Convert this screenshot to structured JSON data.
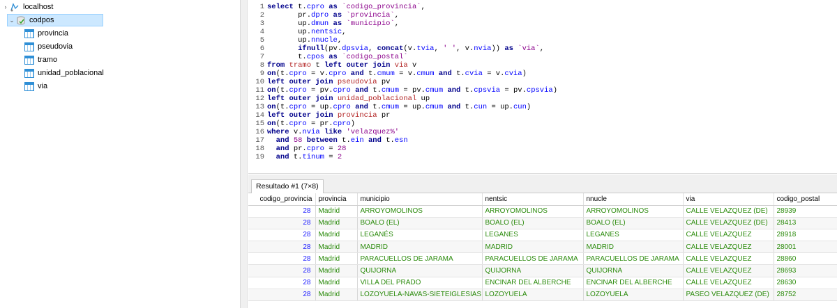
{
  "colors": {
    "keyword": "#00008b",
    "string": "#8b008b",
    "table": "#b22222",
    "number_cell": "#1a1aff",
    "text_cell": "#2b8b0c",
    "selected_bg": "#cce8ff"
  },
  "tree": {
    "server": {
      "label": "localhost",
      "icon": "server-icon"
    },
    "database": {
      "label": "codpos",
      "icon": "database-icon",
      "expanded": true
    },
    "tables": [
      {
        "label": "provincia",
        "icon": "table-icon"
      },
      {
        "label": "pseudovia",
        "icon": "table-icon"
      },
      {
        "label": "tramo",
        "icon": "table-icon"
      },
      {
        "label": "unidad_poblacional",
        "icon": "table-icon"
      },
      {
        "label": "via",
        "icon": "table-icon"
      }
    ]
  },
  "editor": {
    "lines": [
      {
        "n": "1",
        "tokens": [
          [
            "kw",
            "select "
          ],
          [
            "plain",
            "t."
          ],
          [
            "col",
            "cpro"
          ],
          [
            "kw",
            " as "
          ],
          [
            "str",
            "`codigo_provincia`"
          ],
          [
            "plain",
            ","
          ]
        ]
      },
      {
        "n": "2",
        "tokens": [
          [
            "plain",
            "       pr."
          ],
          [
            "col",
            "dpro"
          ],
          [
            "kw",
            " as "
          ],
          [
            "str",
            "`provincia`"
          ],
          [
            "plain",
            ","
          ]
        ]
      },
      {
        "n": "3",
        "tokens": [
          [
            "plain",
            "       up."
          ],
          [
            "col",
            "dmun"
          ],
          [
            "kw",
            " as "
          ],
          [
            "str",
            "`municipio`"
          ],
          [
            "plain",
            ","
          ]
        ]
      },
      {
        "n": "4",
        "tokens": [
          [
            "plain",
            "       up."
          ],
          [
            "col",
            "nentsic"
          ],
          [
            "plain",
            ","
          ]
        ]
      },
      {
        "n": "5",
        "tokens": [
          [
            "plain",
            "       up."
          ],
          [
            "col",
            "nnucle"
          ],
          [
            "plain",
            ","
          ]
        ]
      },
      {
        "n": "6",
        "tokens": [
          [
            "plain",
            "       "
          ],
          [
            "fn",
            "ifnull"
          ],
          [
            "plain",
            "(pv."
          ],
          [
            "col",
            "dpsvia"
          ],
          [
            "plain",
            ", "
          ],
          [
            "fn",
            "concat"
          ],
          [
            "plain",
            "(v."
          ],
          [
            "col",
            "tvia"
          ],
          [
            "plain",
            ", "
          ],
          [
            "str",
            "' '"
          ],
          [
            "plain",
            ", v."
          ],
          [
            "col",
            "nvia"
          ],
          [
            "plain",
            "))"
          ],
          [
            "kw",
            " as "
          ],
          [
            "str",
            "`via`"
          ],
          [
            "plain",
            ","
          ]
        ]
      },
      {
        "n": "7",
        "tokens": [
          [
            "plain",
            "       t."
          ],
          [
            "col",
            "cpos"
          ],
          [
            "kw",
            " as "
          ],
          [
            "str",
            "`codigo_postal`"
          ]
        ]
      },
      {
        "n": "8",
        "tokens": [
          [
            "kw",
            "from "
          ],
          [
            "tbl",
            "tramo"
          ],
          [
            "plain",
            " t "
          ],
          [
            "kw",
            "left outer join "
          ],
          [
            "tbl",
            "via"
          ],
          [
            "plain",
            " v"
          ]
        ]
      },
      {
        "n": "9",
        "tokens": [
          [
            "kw",
            "on"
          ],
          [
            "plain",
            "(t."
          ],
          [
            "col",
            "cpro"
          ],
          [
            "plain",
            " = v."
          ],
          [
            "col",
            "cpro"
          ],
          [
            "kw",
            " and "
          ],
          [
            "plain",
            "t."
          ],
          [
            "col",
            "cmum"
          ],
          [
            "plain",
            " = v."
          ],
          [
            "col",
            "cmum"
          ],
          [
            "kw",
            " and "
          ],
          [
            "plain",
            "t."
          ],
          [
            "col",
            "cvia"
          ],
          [
            "plain",
            " = v."
          ],
          [
            "col",
            "cvia"
          ],
          [
            "plain",
            ")"
          ]
        ]
      },
      {
        "n": "10",
        "tokens": [
          [
            "kw",
            "left outer join "
          ],
          [
            "tbl",
            "pseudovia"
          ],
          [
            "plain",
            " pv"
          ]
        ]
      },
      {
        "n": "11",
        "tokens": [
          [
            "kw",
            "on"
          ],
          [
            "plain",
            "(t."
          ],
          [
            "col",
            "cpro"
          ],
          [
            "plain",
            " = pv."
          ],
          [
            "col",
            "cpro"
          ],
          [
            "kw",
            " and "
          ],
          [
            "plain",
            "t."
          ],
          [
            "col",
            "cmum"
          ],
          [
            "plain",
            " = pv."
          ],
          [
            "col",
            "cmum"
          ],
          [
            "kw",
            " and "
          ],
          [
            "plain",
            "t."
          ],
          [
            "col",
            "cpsvia"
          ],
          [
            "plain",
            " = pv."
          ],
          [
            "col",
            "cpsvia"
          ],
          [
            "plain",
            ")"
          ]
        ]
      },
      {
        "n": "12",
        "tokens": [
          [
            "kw",
            "left outer join "
          ],
          [
            "tbl",
            "unidad_poblacional"
          ],
          [
            "plain",
            " up"
          ]
        ]
      },
      {
        "n": "13",
        "tokens": [
          [
            "kw",
            "on"
          ],
          [
            "plain",
            "(t."
          ],
          [
            "col",
            "cpro"
          ],
          [
            "plain",
            " = up."
          ],
          [
            "col",
            "cpro"
          ],
          [
            "kw",
            " and "
          ],
          [
            "plain",
            "t."
          ],
          [
            "col",
            "cmum"
          ],
          [
            "plain",
            " = up."
          ],
          [
            "col",
            "cmum"
          ],
          [
            "kw",
            " and "
          ],
          [
            "plain",
            "t."
          ],
          [
            "col",
            "cun"
          ],
          [
            "plain",
            " = up."
          ],
          [
            "col",
            "cun"
          ],
          [
            "plain",
            ")"
          ]
        ]
      },
      {
        "n": "14",
        "tokens": [
          [
            "kw",
            "left outer join "
          ],
          [
            "tbl",
            "provincia"
          ],
          [
            "plain",
            " pr"
          ]
        ]
      },
      {
        "n": "15",
        "tokens": [
          [
            "kw",
            "on"
          ],
          [
            "plain",
            "(t."
          ],
          [
            "col",
            "cpro"
          ],
          [
            "plain",
            " = pr."
          ],
          [
            "col",
            "cpro"
          ],
          [
            "plain",
            ")"
          ]
        ]
      },
      {
        "n": "16",
        "tokens": [
          [
            "kw",
            "where "
          ],
          [
            "plain",
            "v."
          ],
          [
            "col",
            "nvia"
          ],
          [
            "kw",
            " like "
          ],
          [
            "str",
            "'velazquez%'"
          ]
        ]
      },
      {
        "n": "17",
        "tokens": [
          [
            "plain",
            "  "
          ],
          [
            "kw",
            "and "
          ],
          [
            "num",
            "58"
          ],
          [
            "kw",
            " between "
          ],
          [
            "plain",
            "t."
          ],
          [
            "col",
            "ein"
          ],
          [
            "kw",
            " and "
          ],
          [
            "plain",
            "t."
          ],
          [
            "col",
            "esn"
          ]
        ]
      },
      {
        "n": "18",
        "tokens": [
          [
            "plain",
            "  "
          ],
          [
            "kw",
            "and "
          ],
          [
            "plain",
            "pr."
          ],
          [
            "col",
            "cpro"
          ],
          [
            "plain",
            " = "
          ],
          [
            "num",
            "28"
          ]
        ]
      },
      {
        "n": "19",
        "tokens": [
          [
            "plain",
            "  "
          ],
          [
            "kw",
            "and "
          ],
          [
            "plain",
            "t."
          ],
          [
            "col",
            "tinum"
          ],
          [
            "plain",
            " = "
          ],
          [
            "num",
            "2"
          ]
        ]
      }
    ]
  },
  "result": {
    "tab_label": "Resultado #1 (7×8)",
    "columns": [
      "codigo_provincia",
      "provincia",
      "municipio",
      "nentsic",
      "nnucle",
      "via",
      "codigo_postal"
    ],
    "rows": [
      [
        "28",
        "Madrid",
        "ARROYOMOLINOS",
        "ARROYOMOLINOS",
        "ARROYOMOLINOS",
        "CALLE VELAZQUEZ (DE)",
        "28939"
      ],
      [
        "28",
        "Madrid",
        "BOALO (EL)",
        "BOALO (EL)",
        "BOALO (EL)",
        "CALLE VELAZQUEZ (DE)",
        "28413"
      ],
      [
        "28",
        "Madrid",
        "LEGANÉS",
        "LEGANES",
        "LEGANES",
        "CALLE VELAZQUEZ",
        "28918"
      ],
      [
        "28",
        "Madrid",
        "MADRID",
        "MADRID",
        "MADRID",
        "CALLE VELAZQUEZ",
        "28001"
      ],
      [
        "28",
        "Madrid",
        "PARACUELLOS DE JARAMA",
        "PARACUELLOS DE JARAMA",
        "PARACUELLOS DE JARAMA",
        "CALLE VELAZQUEZ",
        "28860"
      ],
      [
        "28",
        "Madrid",
        "QUIJORNA",
        "QUIJORNA",
        "QUIJORNA",
        "CALLE VELAZQUEZ",
        "28693"
      ],
      [
        "28",
        "Madrid",
        "VILLA DEL PRADO",
        "ENCINAR DEL ALBERCHE",
        "ENCINAR DEL ALBERCHE",
        "CALLE VELAZQUEZ",
        "28630"
      ],
      [
        "28",
        "Madrid",
        "LOZOYUELA-NAVAS-SIETEIGLESIAS",
        "LOZOYUELA",
        "LOZOYUELA",
        "PASEO VELAZQUEZ (DE)",
        "28752"
      ]
    ]
  }
}
